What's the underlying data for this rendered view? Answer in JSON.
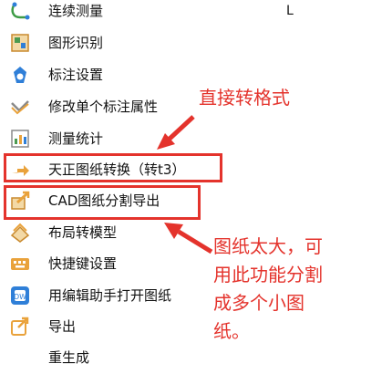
{
  "menu": {
    "items": [
      {
        "label": "连续测量",
        "shortcut": "L",
        "icon": "continuous-measure-icon"
      },
      {
        "label": "图形识别",
        "icon": "shape-recognition-icon"
      },
      {
        "label": "标注设置",
        "icon": "dimension-settings-icon"
      },
      {
        "label": "修改单个标注属性",
        "icon": "edit-dimension-icon"
      },
      {
        "label": "测量统计",
        "icon": "measure-statistics-icon"
      },
      {
        "label": "天正图纸转换（转t3）",
        "icon": "tangent-convert-icon"
      },
      {
        "label": "CAD图纸分割导出",
        "icon": "cad-split-export-icon"
      },
      {
        "label": "布局转模型",
        "icon": "layout-to-model-icon"
      },
      {
        "label": "快捷键设置",
        "icon": "shortcut-settings-icon"
      },
      {
        "label": "用编辑助手打开图纸",
        "icon": "edit-assistant-icon"
      },
      {
        "label": "导出",
        "icon": "export-icon"
      },
      {
        "label": "重生成",
        "icon": "regenerate-icon"
      }
    ]
  },
  "annotations": {
    "convert_note": "直接转格式",
    "split_note_lines": [
      "图纸太大，可",
      "用此功能分割",
      "成多个小图",
      "纸。"
    ]
  },
  "colors": {
    "annotation": "#e4332c",
    "icon_orange": "#e9a23b",
    "icon_blue": "#2f7fd8",
    "icon_green": "#4c9a50"
  }
}
